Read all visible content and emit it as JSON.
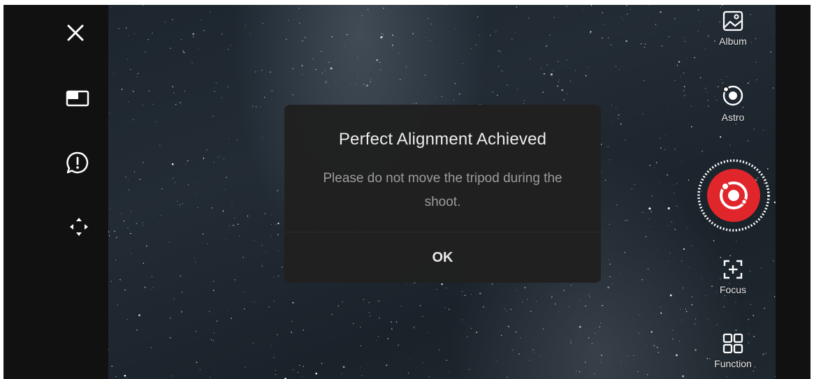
{
  "left_toolbar": {
    "close_icon": "close-icon",
    "aspect_icon": "aspect-ratio-icon",
    "feedback_icon": "alert-bubble-icon",
    "move_icon": "move-arrows-icon"
  },
  "right_toolbar": {
    "album_label": "Album",
    "astro_label": "Astro",
    "focus_label": "Focus",
    "function_label": "Function",
    "shutter_color": "#e0262b"
  },
  "dialog": {
    "title": "Perfect Alignment Achieved",
    "message": "Please do not move the tripod during the shoot.",
    "ok_label": "OK"
  },
  "colors": {
    "background": "#111111",
    "dialog_bg": "#202020",
    "accent_red": "#e0262b"
  }
}
